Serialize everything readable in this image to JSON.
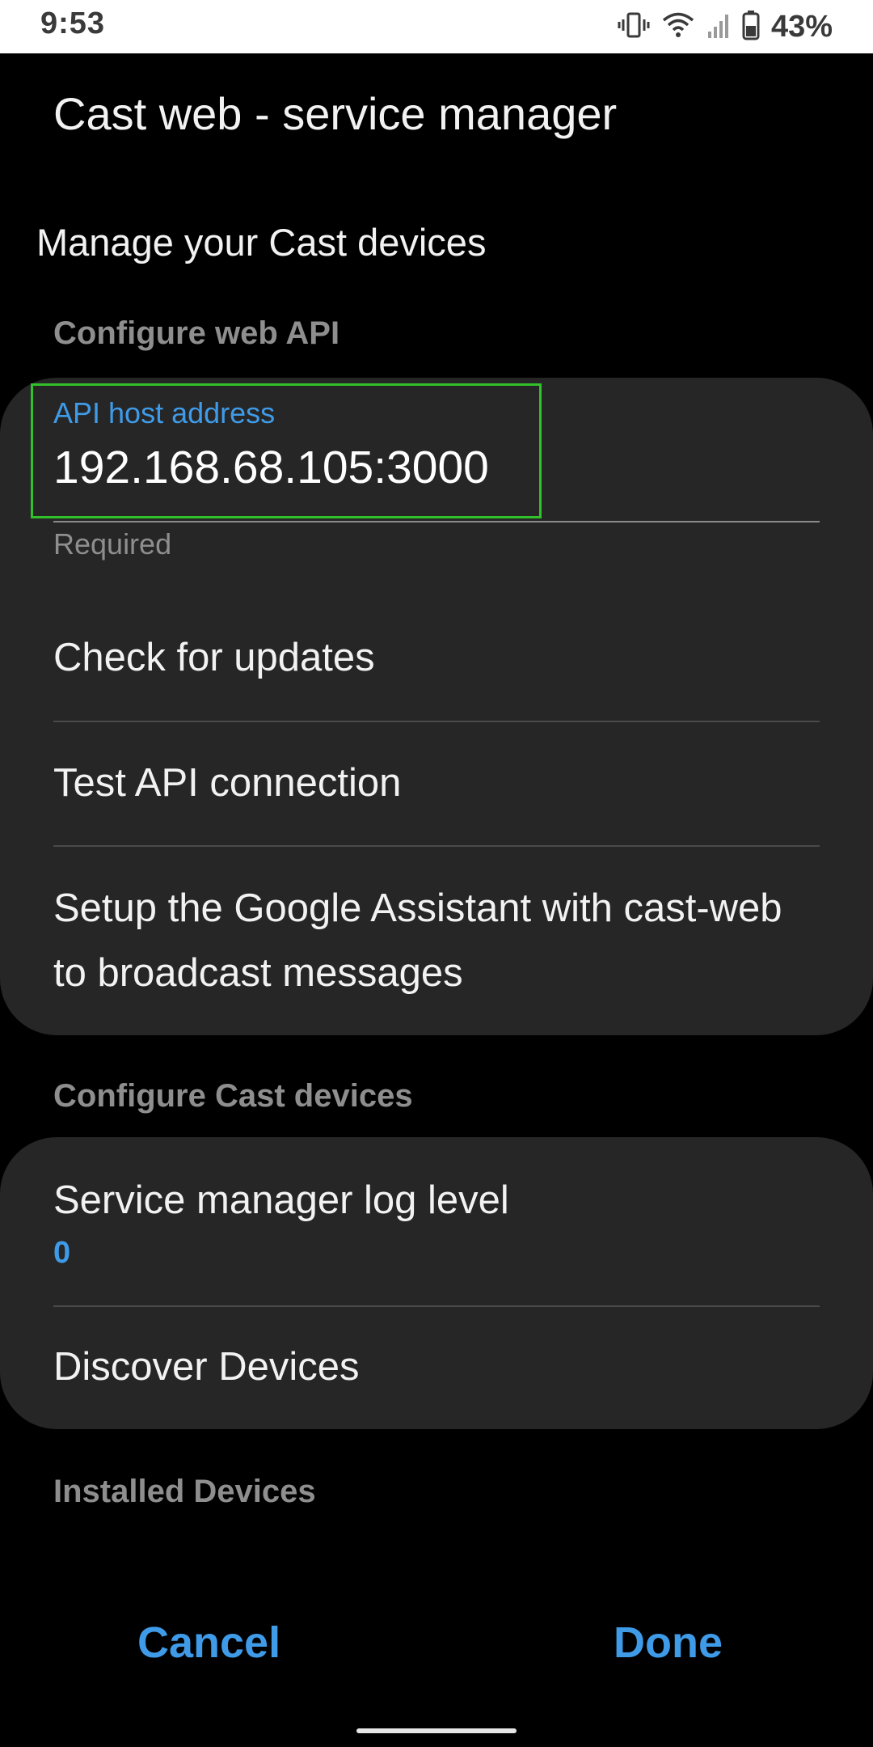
{
  "status_bar": {
    "time": "9:53",
    "battery": "43%",
    "icons": [
      "vibrate-icon",
      "wifi-icon",
      "signal-icon",
      "battery-icon"
    ]
  },
  "app": {
    "title": "Cast web - service manager"
  },
  "page": {
    "heading": "Manage your Cast devices"
  },
  "sections": {
    "web_api": {
      "header": "Configure web API",
      "field": {
        "label": "API host address",
        "value": "192.168.68.105:3000",
        "helper": "Required"
      },
      "items": [
        "Check for updates",
        "Test API connection",
        "Setup the Google Assistant with cast-web to broadcast messages"
      ]
    },
    "cast_devices": {
      "header": "Configure Cast devices",
      "log_level": {
        "label": "Service manager log level",
        "value": "0"
      },
      "discover": "Discover Devices"
    },
    "installed": {
      "header": "Installed Devices"
    }
  },
  "buttons": {
    "cancel": "Cancel",
    "done": "Done"
  },
  "colors": {
    "accent": "#3f9be8",
    "focus_outline": "#31c12b",
    "card_background": "#262626",
    "page_background": "#000000"
  }
}
